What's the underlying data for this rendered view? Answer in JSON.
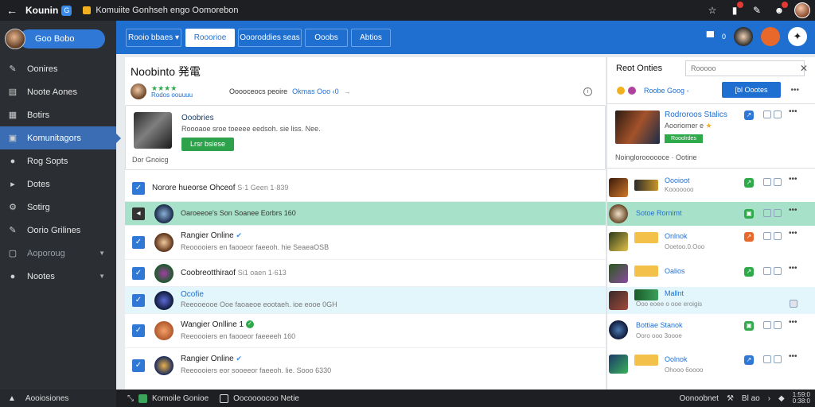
{
  "titlebar": {
    "app_name": "Kounin",
    "app_badge": "G",
    "page_title": "Komuiite Gonhseh engo Oomorebon"
  },
  "sidebar": {
    "top_label": "Goo Bobo",
    "items": [
      {
        "label": "Oonires",
        "icon": "✎"
      },
      {
        "label": "Noote Aones",
        "icon": "▤"
      },
      {
        "label": "Botirs",
        "icon": "▦"
      },
      {
        "label": "Komunitagors",
        "icon": "▣",
        "active": true
      },
      {
        "label": "Rog Sopts",
        "icon": "●"
      },
      {
        "label": "Dotes",
        "icon": "▸"
      },
      {
        "label": "Sotirg",
        "icon": "⚙"
      },
      {
        "label": "Oorio Grilines",
        "icon": "✎"
      },
      {
        "label": "Aoporoug",
        "icon": "▢",
        "dim": true,
        "chevron": true
      },
      {
        "label": "Nootes",
        "icon": "●",
        "chevron": true
      }
    ],
    "bottom_label": "Aooiosiones"
  },
  "header": {
    "tabs": [
      {
        "label": "Rooio bbaes ▾"
      },
      {
        "label": "Rooorioe",
        "selected": true
      },
      {
        "label": "Oooroddies seas"
      },
      {
        "label": "Ooobs"
      },
      {
        "label": "Abtios"
      }
    ],
    "right_count": "0"
  },
  "main": {
    "title": "Noobinto 発電",
    "stars": "★★★★",
    "meta_user": "Rodos oouuuu",
    "meta_text": "Ooooceocs peoire",
    "meta_link": "Okmas Ooo ‹0",
    "feature": {
      "title": "Ooobries",
      "desc": "Roooaoe sroe toeeee eedsoh. sie liss. Nee.",
      "button": "Lrsr bsiese",
      "foot": "Dor Gnoicg"
    },
    "rows": [
      {
        "inline": "Norore hueorse Ohceof",
        "sub": "S·1 Geen 1·839"
      },
      {
        "t1": "Oaroeeoe's Son Soanee Eorbrs 160"
      },
      {
        "t1": "Rangier Online",
        "t2": "Reooooiers en faooeor faeeoh. hie SeaeaOSB"
      },
      {
        "inline": "Coobreotthiraof",
        "sub": "Si1 oaen 1·613"
      },
      {
        "t1": "Ocofie",
        "t2": "Reeooeooe Ooe faoaeoe eootaeh. ioe eooe 0GH"
      },
      {
        "t1": "Wangier Onlline 1",
        "t2": "Reeoooiers en faooeor faeeeeh 160"
      },
      {
        "t1": "Rangier Online",
        "t2": "Reeoooiers eor sooeeor faeeoh. lie. Sooo 6330"
      }
    ]
  },
  "right": {
    "title": "Reot Onties",
    "search_placeholder": "Rooooo",
    "sub_link": "Roobe Goog -",
    "button": "[bl Oootes",
    "feature": {
      "title": "Rodroroos Stalics",
      "sub": "Aooriomer e",
      "tag": "Rooolrdes",
      "foot": "Noingloroooooce · Ootine"
    },
    "rows": [
      {
        "n1": "Oooioot",
        "n2": "Kooooooo",
        "act": "↗"
      },
      {
        "n1": "Sotoe Rornimt",
        "n2": "",
        "act": "▣"
      },
      {
        "n1": "Onlnok",
        "n2": "Ooetoo.0.Ooo",
        "act": "↗"
      },
      {
        "n1": "Oalios",
        "n2": "",
        "act": "↗"
      },
      {
        "n1": "Mallnt",
        "n2": "Ooo eoee o ooe eroigis",
        "act": ""
      },
      {
        "n1": "Bottiae Stanok",
        "n2": "Ooro ooo 3oooe",
        "act": "▣"
      },
      {
        "n1": "Oolnok",
        "n2": "Ohooo 6oooo",
        "act": "↗"
      }
    ]
  },
  "statusbar": {
    "seg1": "Komoile Gonioe",
    "seg2": "Oocoooocoo Netie",
    "right_label": "Oonoobnet",
    "right_code": "Bl ao",
    "time_top": "1:59:0",
    "time_bottom": "0:38:0"
  },
  "colors": {
    "accent": "#1f6fd1",
    "sidebar": "#2b2e33",
    "success": "#2eaa4a",
    "highlight_green": "#a8e1c9",
    "highlight_blue": "#e3f6fc"
  }
}
